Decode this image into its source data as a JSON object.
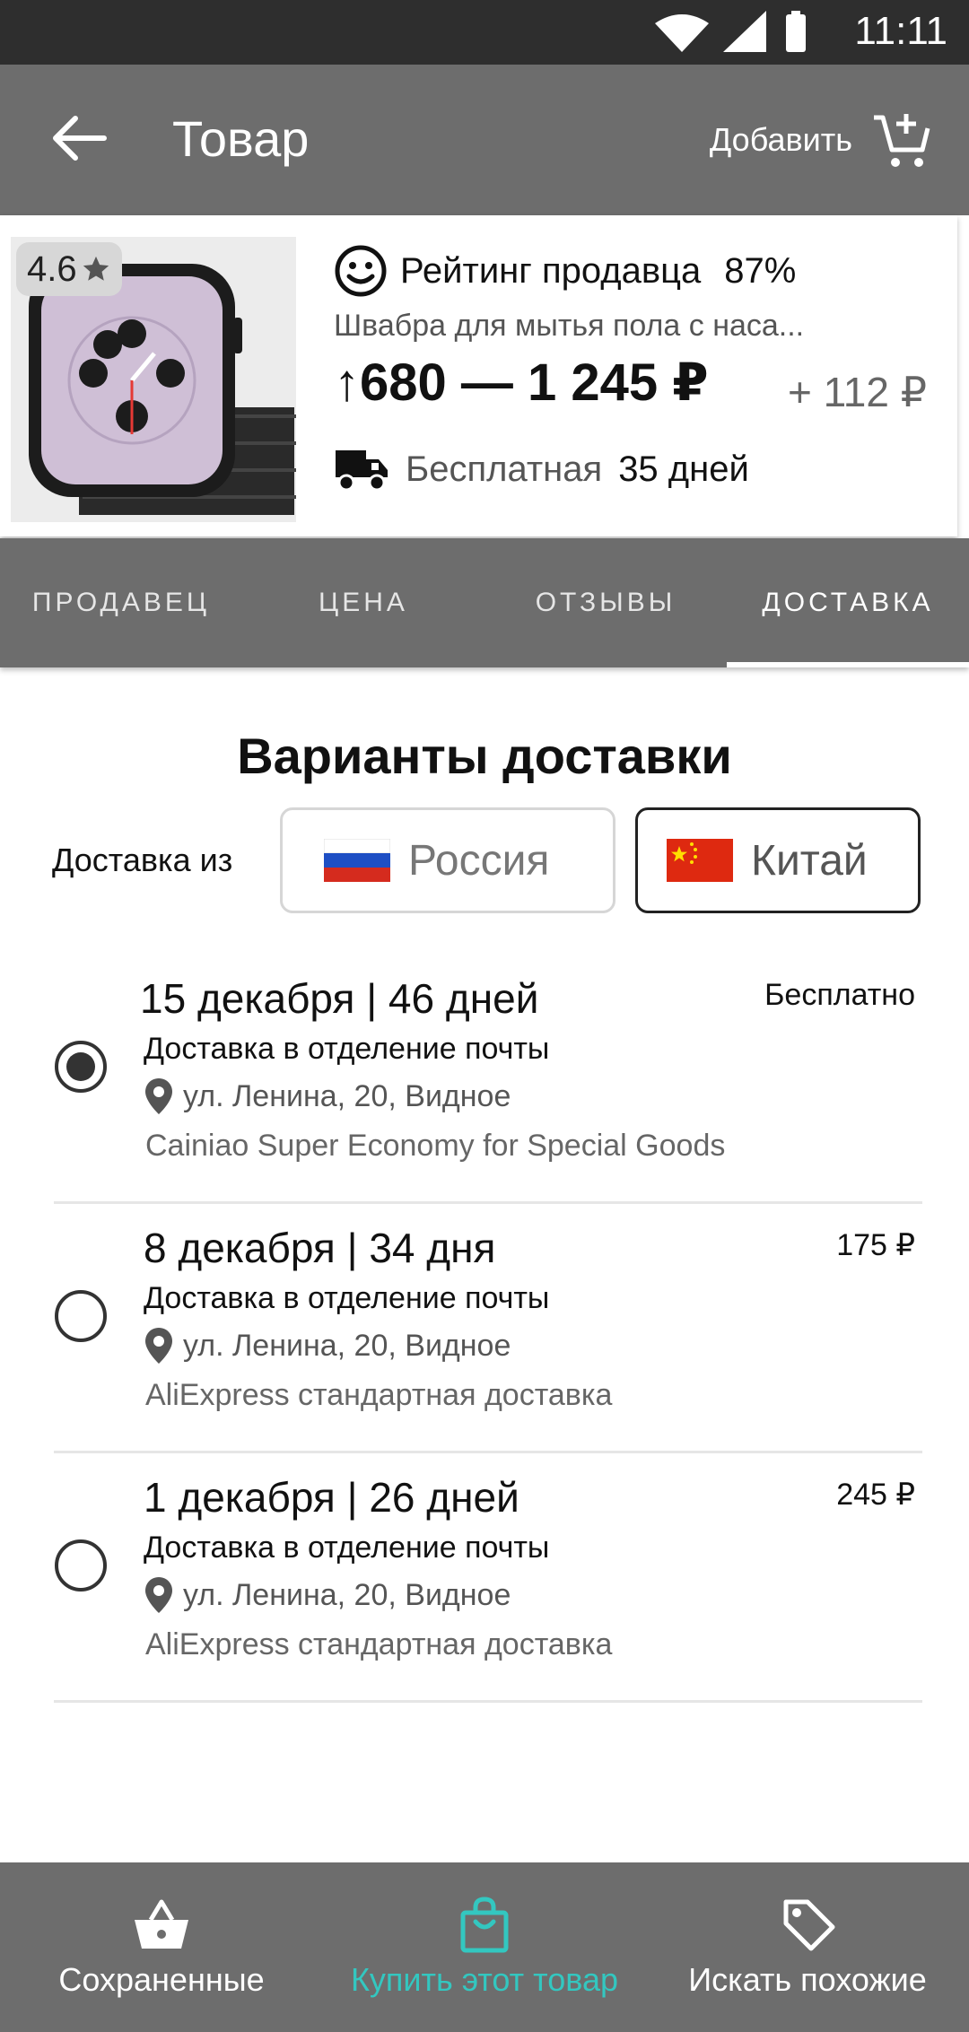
{
  "status_bar": {
    "time": "11:11"
  },
  "app_bar": {
    "title": "Товар",
    "add_label": "Добавить"
  },
  "product": {
    "rating": "4.6",
    "seller_label": "Рейтинг продавца",
    "seller_pct": "87%",
    "name": "Швабра для мытья пола с наса...",
    "price_range": "↑680 — 1 245 ₽",
    "price_extra": "+ 112 ₽",
    "delivery_free": "Бесплатная",
    "delivery_days": "35 дней"
  },
  "tabs": [
    {
      "label": "ПРОДАВЕЦ",
      "active": false
    },
    {
      "label": "ЦЕНА",
      "active": false
    },
    {
      "label": "ОТЗЫВЫ",
      "active": false
    },
    {
      "label": "ДОСТАВКА",
      "active": true
    }
  ],
  "delivery": {
    "title": "Варианты доставки",
    "from_label": "Доставка из",
    "countries": [
      {
        "name": "Россия",
        "selected": false
      },
      {
        "name": "Китай",
        "selected": true
      }
    ],
    "options": [
      {
        "date": "15 декабря  |  46 дней",
        "price": "Бесплатно",
        "method": "Доставка в отделение почты",
        "address": "ул. Ленина, 20, Видное",
        "carrier": "Cainiao Super Economy for Special Goods",
        "selected": true
      },
      {
        "date": "8 декабря  |  34 дня",
        "price": "175 ₽",
        "method": "Доставка в отделение почты",
        "address": "ул. Ленина, 20, Видное",
        "carrier": "AliExpress стандартная доставка",
        "selected": false
      },
      {
        "date": "1 декабря  |  26 дней",
        "price": "245 ₽",
        "method": "Доставка в отделение почты",
        "address": "ул. Ленина, 20, Видное",
        "carrier": "AliExpress стандартная доставка",
        "selected": false
      }
    ]
  },
  "bottom_nav": [
    {
      "label": "Сохраненные",
      "icon": "basket-icon",
      "active": false
    },
    {
      "label": "Купить этот товар",
      "icon": "shopping-bag-icon",
      "active": true
    },
    {
      "label": "Искать похожие",
      "icon": "tag-icon",
      "active": false
    }
  ],
  "colors": {
    "app_bar": "#6d6d6d",
    "accent": "#33c7c0",
    "status_bar": "#2e2e2e"
  }
}
